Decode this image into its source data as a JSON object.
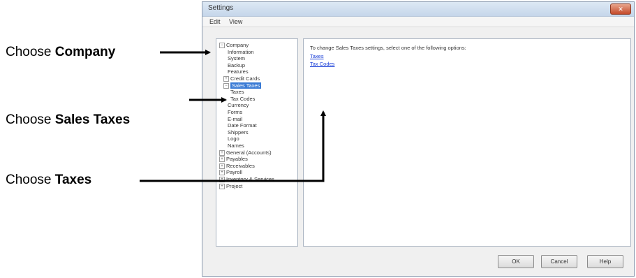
{
  "callouts": [
    {
      "prefix": "Choose ",
      "bold": "Company"
    },
    {
      "prefix": "Choose ",
      "bold": "Sales Taxes"
    },
    {
      "prefix": "Choose ",
      "bold": "Taxes"
    }
  ],
  "window": {
    "title": "Settings",
    "close_label": "✕"
  },
  "menu": [
    "Edit",
    "View"
  ],
  "tree": {
    "items": [
      {
        "label": "Company",
        "expander": "−"
      },
      {
        "label": "Information"
      },
      {
        "label": "System"
      },
      {
        "label": "Backup"
      },
      {
        "label": "Features"
      },
      {
        "label": "Credit Cards",
        "expander": "+"
      },
      {
        "label": "Sales Taxes",
        "expander": "−",
        "selected": true
      },
      {
        "label": "Taxes"
      },
      {
        "label": "Tax Codes"
      },
      {
        "label": "Currency"
      },
      {
        "label": "Forms"
      },
      {
        "label": "E-mail"
      },
      {
        "label": "Date Format"
      },
      {
        "label": "Shippers"
      },
      {
        "label": "Logo"
      },
      {
        "label": "Names"
      },
      {
        "label": "General (Accounts)",
        "expander": "+"
      },
      {
        "label": "Payables",
        "expander": "+"
      },
      {
        "label": "Receivables",
        "expander": "+"
      },
      {
        "label": "Payroll",
        "expander": "+"
      },
      {
        "label": "Inventory & Services",
        "expander": "+"
      },
      {
        "label": "Project",
        "expander": "+"
      }
    ]
  },
  "content": {
    "description": "To change Sales Taxes settings, select one of the following options:",
    "links": [
      "Taxes",
      "Tax Codes"
    ]
  },
  "buttons": {
    "ok": "OK",
    "cancel": "Cancel",
    "help": "Help"
  },
  "colors": {
    "selection": "#3a7bd5",
    "link": "#1a3fd8",
    "arrow": "#000000"
  }
}
